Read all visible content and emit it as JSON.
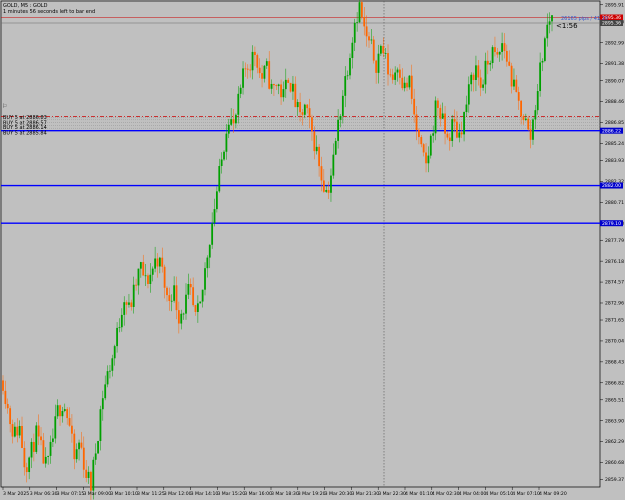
{
  "window": {
    "symbol_title": "GOLD, M5 : GOLD",
    "countdown_text": "1 minutes 56 seconds left to bar end"
  },
  "overlay": {
    "spread_label": "26165 pips / 41.10",
    "timer": "<1:56"
  },
  "orders": [
    {
      "label": "BUY 5 at 2886.83"
    },
    {
      "label": "BUY 5 at 2886.57"
    },
    {
      "label": "BUY 5 at 2886.14"
    },
    {
      "label": "BUY 5 at 2885.84"
    }
  ],
  "price_axis": {
    "ticks": [
      "2895.91",
      "2894.60",
      "2892.99",
      "2891.38",
      "2890.07",
      "2888.46",
      "2886.85",
      "2885.24",
      "2883.93",
      "2882.32",
      "2880.71",
      "2879.10",
      "2877.79",
      "2876.18",
      "2874.57",
      "2872.96",
      "2871.65",
      "2870.04",
      "2868.43",
      "2866.82",
      "2865.51",
      "2863.90",
      "2862.29",
      "2860.68",
      "2859.37"
    ],
    "badges": [
      {
        "text": "2895.36",
        "color": "#cc0000"
      },
      {
        "text": "2895.36",
        "color": "#444444"
      },
      {
        "text": "2886.22",
        "color": "#0000cc"
      },
      {
        "text": "2882.00",
        "color": "#0000cc"
      },
      {
        "text": "2879.10",
        "color": "#0000cc"
      }
    ]
  },
  "time_axis": {
    "ticks": [
      "3 Mar 2025",
      "3 Mar 06:30",
      "3 Mar 07:15",
      "3 Mar 09:00",
      "3 Mar 10:10",
      "3 Mar 11:25",
      "3 Mar 12:00",
      "3 Mar 14:10",
      "3 Mar 15:20",
      "3 Mar 16:00",
      "3 Mar 18:30",
      "3 Mar 19:20",
      "3 Mar 20:30",
      "3 Mar 21:30",
      "3 Mar 22:30",
      "4 Mar 01:10",
      "4 Mar 02:30",
      "4 Mar 04:00",
      "4 Mar 05:10",
      "4 Mar 07:10",
      "4 Mar 09:20"
    ]
  },
  "colors": {
    "background": "#c0c0c0",
    "bull": "#00a000",
    "bear": "#ff6600",
    "level_line": "#0000ff",
    "stop_line": "#cc0000"
  },
  "chart_data": {
    "type": "candlestick",
    "symbol": "GOLD",
    "timeframe": "M5",
    "ylim": [
      2858.8,
      2896.2
    ],
    "horizontal_levels": [
      2886.22,
      2882.0,
      2879.1
    ],
    "dashed_level": 2887.3,
    "current_price": 2895.36,
    "close_path": [
      2867.0,
      2864.5,
      2862.8,
      2863.5,
      2860.5,
      2861.2,
      2862.9,
      2861.5,
      2860.1,
      2862.3,
      2864.7,
      2865.4,
      2863.8,
      2860.8,
      2862.4,
      2860.0,
      2858.9,
      2862.0,
      2865.6,
      2867.4,
      2868.9,
      2871.0,
      2873.6,
      2872.4,
      2874.0,
      2875.8,
      2874.5,
      2875.3,
      2876.6,
      2875.4,
      2873.0,
      2874.2,
      2872.0,
      2872.7,
      2874.0,
      2871.6,
      2872.7,
      2876.2,
      2879.0,
      2881.7,
      2884.4,
      2887.6,
      2886.4,
      2888.6,
      2890.9,
      2891.5,
      2892.4,
      2890.1,
      2891.0,
      2889.2,
      2890.0,
      2888.7,
      2890.6,
      2888.8,
      2887.1,
      2888.0,
      2886.4,
      2884.9,
      2882.8,
      2881.4,
      2883.4,
      2886.6,
      2889.4,
      2891.8,
      2894.6,
      2895.9,
      2893.4,
      2892.6,
      2891.4,
      2892.9,
      2891.0,
      2890.3,
      2891.6,
      2889.4,
      2890.0,
      2887.0,
      2884.8,
      2883.4,
      2885.7,
      2888.6,
      2886.9,
      2885.4,
      2886.9,
      2885.8,
      2887.4,
      2889.5,
      2891.3,
      2889.6,
      2891.0,
      2892.3,
      2891.6,
      2893.0,
      2891.4,
      2889.5,
      2888.1,
      2887.3,
      2885.4,
      2888.4,
      2891.4,
      2894.0,
      2895.4
    ]
  }
}
